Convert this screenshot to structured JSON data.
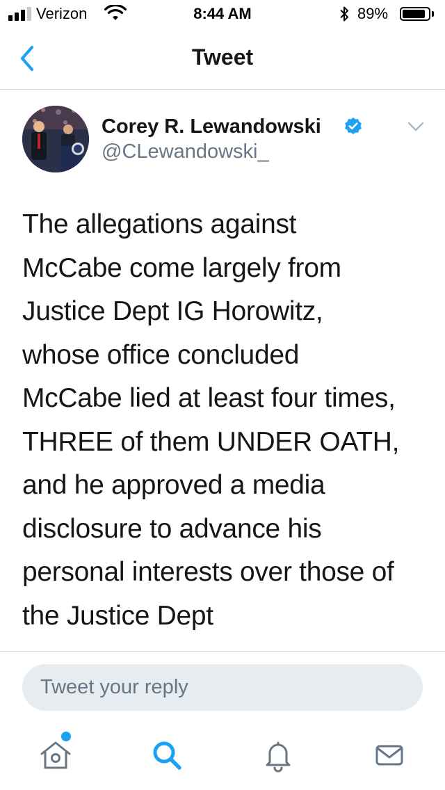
{
  "status_bar": {
    "carrier": "Verizon",
    "time": "8:44 AM",
    "battery_percent_label": "89%",
    "battery_level": 0.89,
    "signal_bars_total": 4,
    "signal_bars_filled": 3
  },
  "nav": {
    "title": "Tweet",
    "back_icon": "chevron-left-icon"
  },
  "tweet": {
    "author_name": "Corey R. Lewandowski",
    "author_handle": "@CLewandowski_",
    "verified": true,
    "text_lines": [
      "The allegations against",
      "McCabe come largely from",
      "Justice Dept IG Horowitz,",
      "whose office concluded",
      "McCabe lied at least four times,",
      "THREE of them UNDER OATH,",
      "and he approved a media",
      "disclosure to advance his",
      "personal interests over those of",
      "the Justice Dept"
    ]
  },
  "reply": {
    "placeholder": "Tweet your reply"
  },
  "tab_bar": {
    "items": [
      {
        "name": "home",
        "icon": "home-icon",
        "has_badge": true
      },
      {
        "name": "search",
        "icon": "search-icon",
        "active": true
      },
      {
        "name": "notifications",
        "icon": "bell-icon"
      },
      {
        "name": "messages",
        "icon": "envelope-icon"
      }
    ]
  },
  "colors": {
    "accent": "#1da1f2",
    "text_primary": "#14171a",
    "text_secondary": "#657786",
    "reply_background": "#e6ecf0",
    "divider": "#d9d9d9"
  }
}
